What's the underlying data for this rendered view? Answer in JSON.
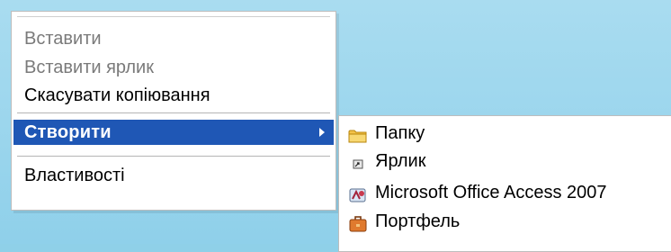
{
  "context_menu": {
    "items": [
      {
        "label": "Вставити",
        "state": "disabled"
      },
      {
        "label": "Вставити ярлик",
        "state": "disabled"
      },
      {
        "label": "Скасувати копіювання",
        "state": "enabled"
      },
      {
        "label": "Створити",
        "state": "highlighted",
        "has_submenu": true
      },
      {
        "label": "Властивості",
        "state": "enabled"
      }
    ]
  },
  "submenu": {
    "items": [
      {
        "label": "Папку",
        "icon": "folder-icon"
      },
      {
        "label": "Ярлик",
        "icon": "shortcut-icon"
      },
      {
        "label": "Microsoft Office Access 2007",
        "icon": "access-icon"
      },
      {
        "label": "Портфель",
        "icon": "briefcase-icon"
      }
    ]
  },
  "colors": {
    "desktop": "#a9dcf0",
    "highlight": "#1f57b5",
    "disabled_text": "#7a7a7a"
  }
}
